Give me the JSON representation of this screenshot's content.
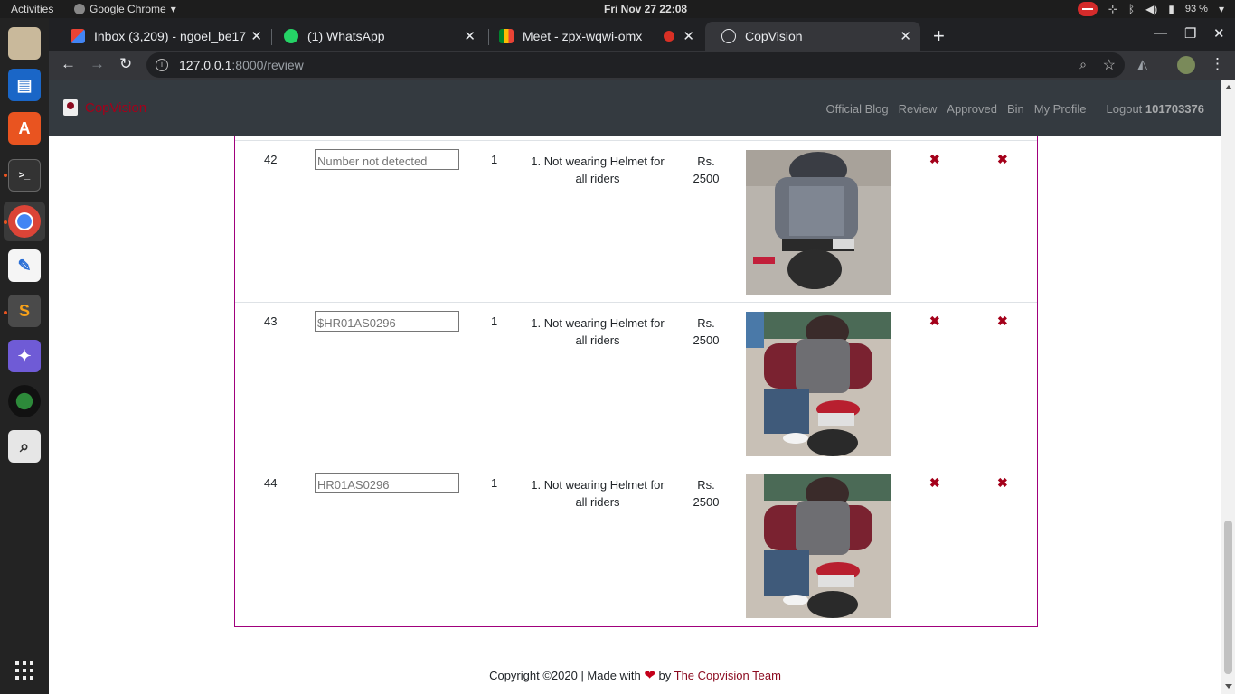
{
  "system": {
    "activities": "Activities",
    "app_name": "Google Chrome",
    "clock": "Fri Nov 27  22:08",
    "battery": "93 %"
  },
  "tabs": [
    {
      "title": "Inbox (3,209) - ngoel_be17",
      "icon": "gmail-icon"
    },
    {
      "title": "(1) WhatsApp",
      "icon": "whatsapp-icon"
    },
    {
      "title": "Meet - zpx-wqwi-omx",
      "icon": "meet-icon"
    },
    {
      "title": "CopVision",
      "icon": "globe-icon"
    }
  ],
  "address": {
    "host": "127.0.0.1",
    "path": ":8000/review"
  },
  "site": {
    "brand": "CopVision",
    "nav": [
      "Official Blog",
      "Review",
      "Approved",
      "Bin",
      "My Profile"
    ],
    "logout_label": "Logout",
    "user_id": "101703376"
  },
  "rows": [
    {
      "num": "42",
      "plate_value": "",
      "plate_placeholder": "Number not detected",
      "count": "1",
      "offense": "1. Not wearing Helmet for all riders",
      "fine": "Rs. 2500"
    },
    {
      "num": "43",
      "plate_value": "$HR01AS0296",
      "plate_placeholder": "",
      "count": "1",
      "offense": "1. Not wearing Helmet for all riders",
      "fine": "Rs. 2500"
    },
    {
      "num": "44",
      "plate_value": "HR01AS0296",
      "plate_placeholder": "",
      "count": "1",
      "offense": "1. Not wearing Helmet for all riders",
      "fine": "Rs. 2500"
    }
  ],
  "footer": {
    "text": "Copyright ©2020 | Made with",
    "by": "by",
    "team": "The Copvision Team"
  },
  "colors": {
    "brand": "#a4001a",
    "navbar": "#343a40",
    "table_border": "#a0007c"
  }
}
